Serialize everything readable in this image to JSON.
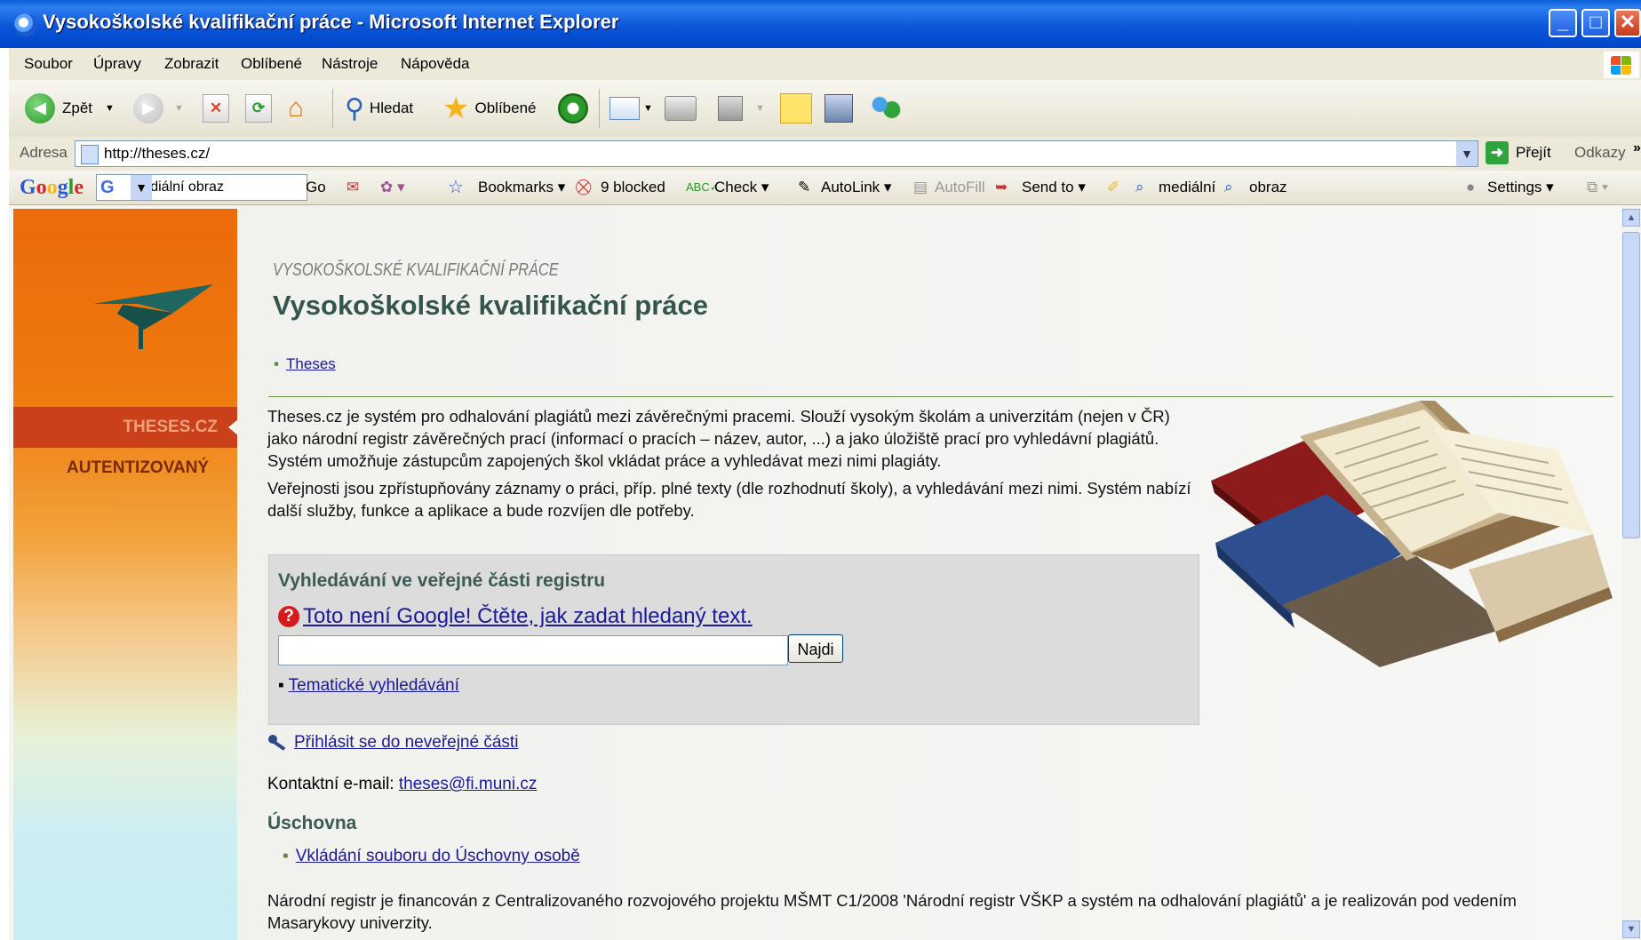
{
  "window": {
    "title": "Vysokoškolské kvalifikační práce - Microsoft Internet Explorer",
    "buttons": {
      "minimize": "_",
      "maximize": "□",
      "close": "✕"
    }
  },
  "menu": [
    "Soubor",
    "Úpravy",
    "Zobrazit",
    "Oblíbené",
    "Nástroje",
    "Nápověda"
  ],
  "toolbar": {
    "back": "Zpět",
    "search": "Hledat",
    "favorites": "Oblíbené"
  },
  "address": {
    "label": "Adresa",
    "url": "http://theses.cz/",
    "go": "Přejít",
    "links": "Odkazy"
  },
  "google_toolbar": {
    "logo": "Google",
    "query": "mediální obraz",
    "go": "Go",
    "bookmarks": "Bookmarks",
    "blocked": "9 blocked",
    "check": "Check",
    "autolink": "AutoLink",
    "autofill": "AutoFill",
    "sendto": "Send to",
    "term1": "mediální",
    "term2": "obraz",
    "settings": "Settings"
  },
  "sidebar": {
    "items": [
      "THESES.CZ",
      "AUTENTIZOVANÝ"
    ]
  },
  "page": {
    "kicker": "VYSOKOŠKOLSKÉ KVALIFIKAČNÍ PRÁCE",
    "title": "Vysokoškolské kvalifikační práce",
    "breadcrumb": "Theses",
    "para1": "Theses.cz je systém pro odhalování plagiátů mezi závěrečnými pracemi. Slouží vysokým školám a univerzitám (nejen v ČR) jako národní registr závěrečných prací (informací o pracích – název, autor, ...) a jako úložiště prací pro vyhledávní plagiátů. Systém umožňuje zástupcům zapojených škol vkládat práce a vyhledávat mezi nimi plagiáty.",
    "para2": "Veřejnosti jsou zpřístupňovány záznamy o práci, příp. plné texty (dle rozhodnutí školy), a vyhledávání mezi nimi. Systém nabízí další služby, funkce a aplikace a bude rozvíjen dle potřeby.",
    "search": {
      "heading": "Vyhledávání ve veřejné části registru",
      "help": "Toto není Google! Čtěte, jak zadat hledaný text.",
      "input_value": "",
      "button": "Najdi",
      "thematic": "Tematické vyhledávání"
    },
    "login": "Přihlásit se do neveřejné části",
    "email_label": "Kontaktní e-mail: ",
    "email": "theses@fi.muni.cz",
    "storage_heading": "Úschovna",
    "storage_link": "Vkládání souboru do Úschovny osobě",
    "footer": "Národní registr je financován z Centralizovaného rozvojového projektu MŠMT C1/2008 'Národní registr VŠKP a systém na odhalování plagiátů' a je realizován pod vedením Masarykovy univerzity."
  },
  "colors": {
    "accent_green": "#34554e",
    "sidebar_orange": "#ec6a0a",
    "active_red": "#c9401a",
    "link": "#1a1a9a"
  }
}
